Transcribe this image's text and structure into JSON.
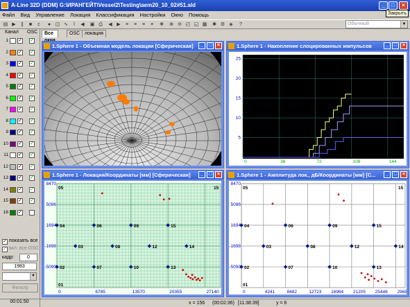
{
  "window": {
    "title": "A-Line 32D (DDM) G:\\ИРАНГЕЙТ\\Vessel2\\Testing\\aem20_10_02#51.ald",
    "tooltip": "Закрыть"
  },
  "menu": [
    "Файл",
    "Вид",
    "Управление",
    "Локация",
    "Классификация",
    "Настройки",
    "Окно",
    "Помощь"
  ],
  "toolbar": {
    "combo_value": "Обычный"
  },
  "left_panel": {
    "header_channel": "Канал",
    "header_osc": "OSC",
    "channels": [
      {
        "num": "1",
        "color": "#ffffff",
        "osc": true
      },
      {
        "num": "2",
        "color": "#ff8000",
        "osc": true
      },
      {
        "num": "3",
        "color": "#0000ff",
        "osc": true
      },
      {
        "num": "4",
        "color": "#ff0000",
        "osc": true
      },
      {
        "num": "5",
        "color": "#008000",
        "osc": true
      },
      {
        "num": "6",
        "color": "#00ff00",
        "osc": true
      },
      {
        "num": "7",
        "color": "#ff00ff",
        "osc": true
      },
      {
        "num": "8",
        "color": "#00ffff",
        "osc": true
      },
      {
        "num": "9",
        "color": "#000080",
        "osc": true
      },
      {
        "num": "10",
        "color": "#800080",
        "osc": true
      },
      {
        "num": "11",
        "color": "#ffffff",
        "osc": true
      },
      {
        "num": "12",
        "color": "#c0c0c0",
        "osc": true
      },
      {
        "num": "13",
        "color": "#000080",
        "osc": true
      },
      {
        "num": "14",
        "color": "#808000",
        "osc": true
      },
      {
        "num": "15",
        "color": "#804000",
        "osc": true
      },
      {
        "num": "16",
        "color": "#008000",
        "osc": false
      }
    ],
    "show_all_label": "показать все",
    "all_osc_label": "вкл. все OSC",
    "frame_label": "кадр:",
    "frame_value": "0",
    "count_value": "1983",
    "filter_button": "Фильтр",
    "time_value": "00:01:50"
  },
  "tabs": [
    "Все окна",
    "OSC",
    "локация"
  ],
  "panes": {
    "top_left": {
      "title": "1.Sphere 1 - Объемная модель локации [Сферическая]"
    },
    "top_right": {
      "title": "1.Sphere 1 - Накопление слоцированных импульсов"
    },
    "bottom_left": {
      "title": "1.Sphere 1 - Локация/Координаты [мм] [Сферическая]"
    },
    "bottom_right": {
      "title": "1.Sphere 1 - Амплитуда лок., дБ/Координаты [мм] [С..."
    }
  },
  "chart_data": [
    {
      "type": "line",
      "title": "",
      "x_ticks": [
        "0",
        "36",
        "72",
        "108",
        "144"
      ],
      "y_ticks": [
        "5",
        "10",
        "15",
        "20",
        "25"
      ],
      "xlim": [
        0,
        160
      ],
      "ylim": [
        0,
        26
      ],
      "grid": true,
      "series": [
        {
          "color": "#ffff80",
          "x": [
            0,
            66,
            66,
            70,
            70,
            74,
            74,
            78,
            78,
            82,
            82,
            86,
            86,
            90,
            90,
            94,
            94,
            98,
            98,
            102,
            102,
            108
          ],
          "y": [
            0,
            0,
            2,
            2,
            3,
            3,
            5,
            5,
            7,
            7,
            9,
            9,
            10,
            10,
            12,
            12,
            13,
            13,
            15,
            15,
            16,
            16
          ]
        },
        {
          "color": "#a0a0ff",
          "x": [
            0,
            70,
            70,
            76,
            76,
            82,
            82,
            88,
            88,
            94,
            94,
            100,
            100,
            106,
            106,
            160
          ],
          "y": [
            0,
            0,
            1,
            1,
            3,
            3,
            5,
            5,
            7,
            7,
            9,
            9,
            11,
            11,
            13,
            13
          ]
        },
        {
          "color": "#6060ff",
          "x": [
            0,
            76,
            76,
            84,
            84,
            92,
            92,
            100,
            100,
            160
          ],
          "y": [
            0,
            0,
            1,
            1,
            2,
            2,
            4,
            4,
            5,
            5
          ]
        }
      ]
    },
    {
      "type": "scatter",
      "title": "",
      "x_ticks": [
        "0",
        "6785",
        "13570",
        "20355",
        "27140"
      ],
      "y_ticks": [
        "8470",
        "5086",
        "1694",
        "-1698",
        "-5090"
      ],
      "corner_labels": [
        "05",
        "15",
        "01"
      ],
      "sensors": [
        {
          "label": "04",
          "x": 0,
          "y": 1694
        },
        {
          "label": "06",
          "x": 6785,
          "y": 1694
        },
        {
          "label": "09",
          "x": 13570,
          "y": 1694
        },
        {
          "label": "15",
          "x": 20355,
          "y": 1694
        },
        {
          "label": "03",
          "x": 3392,
          "y": -1698
        },
        {
          "label": "08",
          "x": 10177,
          "y": -1698
        },
        {
          "label": "12",
          "x": 16962,
          "y": -1698
        },
        {
          "label": "14",
          "x": 23747,
          "y": -1698
        },
        {
          "label": "02",
          "x": 0,
          "y": -5090
        },
        {
          "label": "07",
          "x": 6785,
          "y": -5090
        },
        {
          "label": "10",
          "x": 13570,
          "y": -5090
        },
        {
          "label": "13",
          "x": 20355,
          "y": -5090
        }
      ],
      "events": [
        {
          "x": 8300,
          "y": 6900
        },
        {
          "x": 18900,
          "y": 6600
        },
        {
          "x": 20600,
          "y": 6000
        },
        {
          "x": 19600,
          "y": 5900
        },
        {
          "x": 23100,
          "y": -5600
        },
        {
          "x": 23700,
          "y": -6300
        },
        {
          "x": 24100,
          "y": -6700
        },
        {
          "x": 24500,
          "y": -6900
        },
        {
          "x": 24900,
          "y": -7100
        },
        {
          "x": 25300,
          "y": -6800
        },
        {
          "x": 25600,
          "y": -7200
        },
        {
          "x": 25900,
          "y": -7000
        },
        {
          "x": 26200,
          "y": -7300
        },
        {
          "x": 24800,
          "y": -6400
        },
        {
          "x": 26600,
          "y": -6900
        }
      ]
    },
    {
      "type": "scatter",
      "title": "",
      "x_ticks": [
        "0",
        "4241",
        "8482",
        "12723",
        "16964",
        "21205",
        "25446",
        "29687"
      ],
      "y_ticks": [
        "8470",
        "5086",
        "1694",
        "-1698",
        "-5090"
      ],
      "corner_labels": [
        "05",
        "15",
        "01"
      ],
      "sensors": [
        {
          "label": "04",
          "x": 0,
          "y": 1694
        },
        {
          "label": "06",
          "x": 8482,
          "y": 1694
        },
        {
          "label": "09",
          "x": 16964,
          "y": 1694
        },
        {
          "label": "15",
          "x": 25446,
          "y": 1694
        },
        {
          "label": "03",
          "x": 4241,
          "y": -1698
        },
        {
          "label": "08",
          "x": 12723,
          "y": -1698
        },
        {
          "label": "12",
          "x": 21205,
          "y": -1698
        },
        {
          "label": "14",
          "x": 29687,
          "y": -1698
        },
        {
          "label": "02",
          "x": 0,
          "y": -5090
        },
        {
          "label": "07",
          "x": 8482,
          "y": -5090
        },
        {
          "label": "10",
          "x": 16964,
          "y": -5090
        },
        {
          "label": "13",
          "x": 25446,
          "y": -5090
        }
      ],
      "events": [
        {
          "x": 6000,
          "y": 5200
        },
        {
          "x": 18700,
          "y": 6700
        },
        {
          "x": 19700,
          "y": 5700
        },
        {
          "x": 23100,
          "y": -6100
        },
        {
          "x": 23800,
          "y": -6800
        },
        {
          "x": 24500,
          "y": -7200
        },
        {
          "x": 25000,
          "y": -6600
        },
        {
          "x": 25600,
          "y": -7000
        },
        {
          "x": 26300,
          "y": -7400
        },
        {
          "x": 27000,
          "y": -7100
        },
        {
          "x": 27800,
          "y": -7600
        },
        {
          "x": 24300,
          "y": -6300
        }
      ]
    }
  ],
  "status": {
    "x_label": "x = 156",
    "time1": "(00:02:36)",
    "time2": "[11:38:39]",
    "y_label": "y = 6"
  }
}
